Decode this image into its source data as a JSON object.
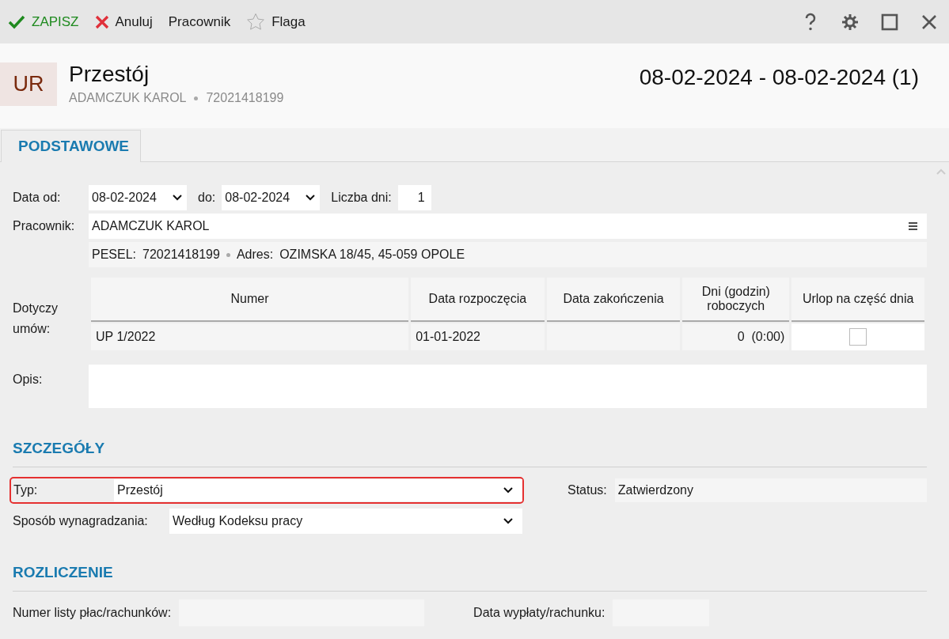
{
  "toolbar": {
    "actions": [
      {
        "kind": "save",
        "label": "ZAPISZ"
      },
      {
        "kind": "cancel",
        "label": "Anuluj"
      },
      {
        "kind": "plain",
        "label": "Pracownik"
      },
      {
        "kind": "flag",
        "label": "Flaga"
      }
    ]
  },
  "header": {
    "badge": "UR",
    "title": "Przestój",
    "employee": "ADAMCZUK KAROL",
    "pesel": "72021418199",
    "date_range": "08-02-2024 - 08-02-2024 (1)"
  },
  "tabs": [
    {
      "label": "PODSTAWOWE",
      "selected": true
    }
  ],
  "form": {
    "date_from_label": "Data od:",
    "date_from": "08-02-2024",
    "date_to_label": "do:",
    "date_to": "08-02-2024",
    "days_label": "Liczba dni:",
    "days": "1",
    "employee_label": "Pracownik:",
    "employee": "ADAMCZUK KAROL",
    "pesel_label": "PESEL:",
    "pesel": "72021418199",
    "address_label": "Adres:",
    "address": "OZIMSKA 18/45, 45-059 OPOLE",
    "contracts_label": "Dotyczy umów:",
    "contracts": {
      "columns": [
        "Numer",
        "Data rozpoczęcia",
        "Data zakończenia",
        "Dni (godzin) roboczych",
        "Urlop na część dnia"
      ],
      "rows": [
        {
          "number": "UP 1/2022",
          "start": "01-01-2022",
          "end": "",
          "days": "0  (0:00)",
          "partial_day": false
        }
      ]
    },
    "description_label": "Opis:"
  },
  "details": {
    "heading": "SZCZEGÓŁY",
    "type_label": "Typ:",
    "type": "Przestój",
    "type_highlighted": true,
    "status_label": "Status:",
    "status": "Zatwierdzony",
    "payment_label": "Sposób wynagradzania:",
    "payment": "Według Kodeksu pracy"
  },
  "settlement": {
    "heading": "ROZLICZENIE",
    "payroll_label": "Numer listy płac/rachunków:",
    "payout_label": "Data wypłaty/rachunku:"
  }
}
